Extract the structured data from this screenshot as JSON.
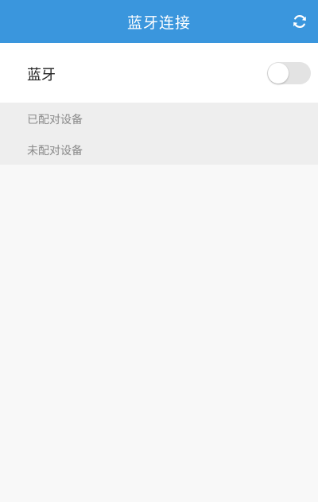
{
  "header": {
    "title": "蓝牙连接",
    "refresh_icon": "refresh-icon"
  },
  "bluetooth": {
    "label": "蓝牙",
    "toggle_state": "off"
  },
  "sections": {
    "paired_label": "已配对设备",
    "unpaired_label": "未配对设备"
  },
  "colors": {
    "header_bg": "#3a96dd",
    "header_text": "#ffffff",
    "section_bg": "#eeeeee",
    "section_text": "#8a8a8a",
    "toggle_off": "#e3e3e3",
    "page_bg": "#f8f8f8"
  }
}
